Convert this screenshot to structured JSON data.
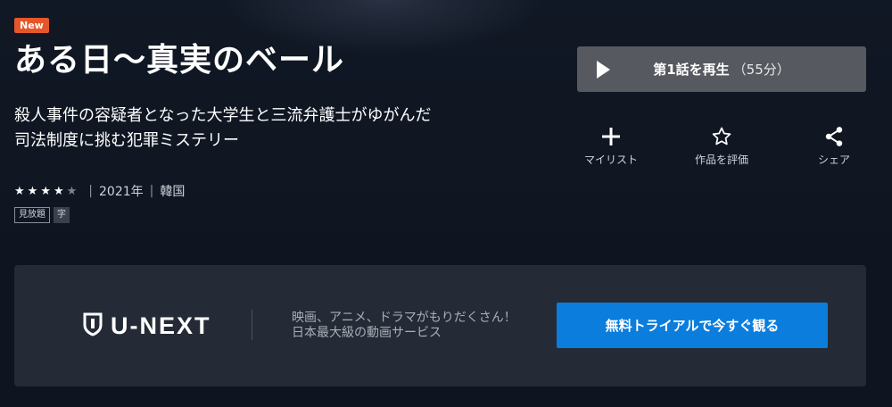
{
  "badge": "New",
  "title": "ある日～真実のベール",
  "description": {
    "line1": "殺人事件の容疑者となった大学生と三流弁護士がゆがんだ",
    "line2": "司法制度に挑む犯罪ミステリー"
  },
  "rating": {
    "value": 4,
    "max": 5,
    "filled_color": "#ffffff",
    "empty_color": "#7c8391"
  },
  "meta": {
    "year": "2021年",
    "country": "韓国",
    "separator": "|"
  },
  "tags": [
    "見放題",
    "字"
  ],
  "play": {
    "label": "第1話を再生",
    "duration": "（55分）",
    "icon": "play-icon"
  },
  "actions": [
    {
      "label": "マイリスト",
      "icon": "plus-icon"
    },
    {
      "label": "作品を評価",
      "icon": "star-outline-icon"
    },
    {
      "label": "シェア",
      "icon": "share-icon"
    }
  ],
  "banner": {
    "logo": "U-NEXT",
    "tagline1": "映画、アニメ、ドラマがもりだくさん！",
    "tagline2": "日本最大級の動画サービス",
    "cta": "無料トライアルで今すぐ観る",
    "cta_color": "#0a7ddd"
  },
  "colors": {
    "background": "#0f1520",
    "badge": "#e5572a",
    "play_button": "#56595f",
    "banner": "#252b36"
  }
}
